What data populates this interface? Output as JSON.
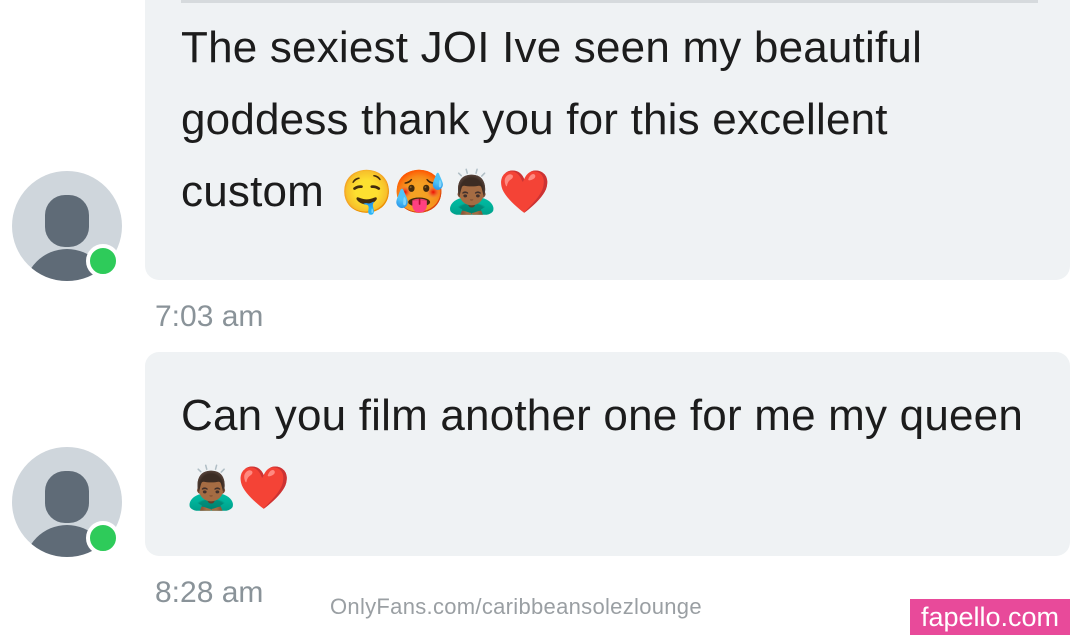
{
  "messages": [
    {
      "text": "The sexiest JOI Ive seen my beautiful goddess thank you for this excellent custom",
      "emojis": "🤤🥵🙇🏾‍♂️❤️",
      "time": "7:03 am"
    },
    {
      "text": "Can you film another one for me my queen",
      "emojis": "🙇🏾‍♂️❤️",
      "time": "8:28 am"
    }
  ],
  "watermark": {
    "url": "OnlyFans.com/caribbeansolezlounge",
    "brand": "fapello.com"
  },
  "colors": {
    "bubble_bg": "#eff2f4",
    "online_dot": "#2ecb5a",
    "avatar_bg": "#cfd6dc",
    "avatar_fg": "#5f6b77",
    "timestamp": "#8a9399",
    "brand_bg": "#e84a9a"
  },
  "icons": {
    "avatar": "default-user-avatar-icon",
    "status": "online-status-dot"
  }
}
